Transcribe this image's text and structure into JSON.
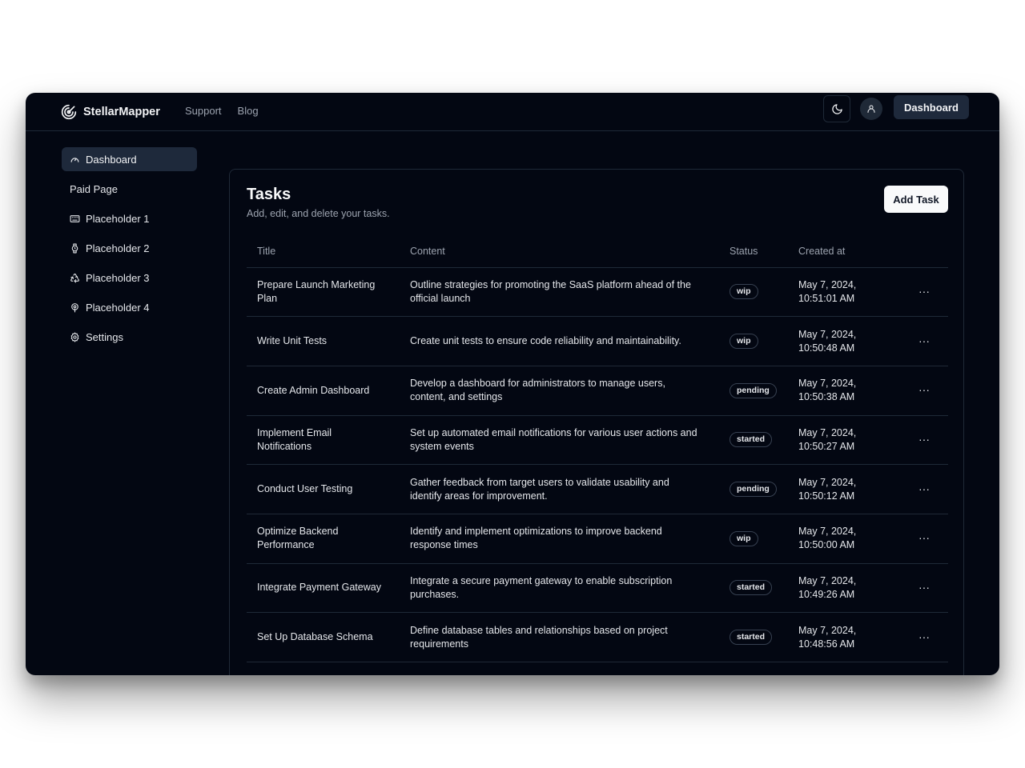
{
  "header": {
    "brand": "StellarMapper",
    "nav": [
      "Support",
      "Blog"
    ],
    "dashboard_button": "Dashboard"
  },
  "sidebar": {
    "items": [
      {
        "label": "Dashboard",
        "icon": "gauge-icon",
        "active": true
      },
      {
        "label": "Paid Page",
        "icon": "",
        "heading": true
      },
      {
        "label": "Placeholder 1",
        "icon": "keyboard-icon"
      },
      {
        "label": "Placeholder 2",
        "icon": "watch-icon"
      },
      {
        "label": "Placeholder 3",
        "icon": "recycle-icon"
      },
      {
        "label": "Placeholder 4",
        "icon": "podcast-icon"
      },
      {
        "label": "Settings",
        "icon": "gear-icon"
      }
    ]
  },
  "main": {
    "title": "Tasks",
    "subtitle": "Add, edit, and delete your tasks.",
    "add_button": "Add Task",
    "columns": [
      "Title",
      "Content",
      "Status",
      "Created at"
    ],
    "rows": [
      {
        "title": "Prepare Launch Marketing Plan",
        "content": "Outline strategies for promoting the SaaS platform ahead of the official launch",
        "status": "wip",
        "created_line1": "May 7, 2024,",
        "created_line2": "10:51:01 AM"
      },
      {
        "title": "Write Unit Tests",
        "content": "Create unit tests to ensure code reliability and maintainability.",
        "status": "wip",
        "created_line1": "May 7, 2024,",
        "created_line2": "10:50:48 AM"
      },
      {
        "title": "Create Admin Dashboard",
        "content": "Develop a dashboard for administrators to manage users, content, and settings",
        "status": "pending",
        "created_line1": "May 7, 2024,",
        "created_line2": "10:50:38 AM"
      },
      {
        "title": "Implement Email Notifications",
        "content": "Set up automated email notifications for various user actions and system events",
        "status": "started",
        "created_line1": "May 7, 2024,",
        "created_line2": "10:50:27 AM"
      },
      {
        "title": "Conduct User Testing",
        "content": "Gather feedback from target users to validate usability and identify areas for improvement.",
        "status": "pending",
        "created_line1": "May 7, 2024,",
        "created_line2": "10:50:12 AM"
      },
      {
        "title": "Optimize Backend Performance",
        "content": "Identify and implement optimizations to improve backend response times",
        "status": "wip",
        "created_line1": "May 7, 2024,",
        "created_line2": "10:50:00 AM"
      },
      {
        "title": "Integrate Payment Gateway",
        "content": "Integrate a secure payment gateway to enable subscription purchases.",
        "status": "started",
        "created_line1": "May 7, 2024,",
        "created_line2": "10:49:26 AM"
      },
      {
        "title": "Set Up Database Schema",
        "content": "Define database tables and relationships based on project requirements",
        "status": "started",
        "created_line1": "May 7, 2024,",
        "created_line2": "10:48:56 AM"
      }
    ],
    "row_action": "···"
  },
  "colors": {
    "background": "#030712",
    "border": "#1f2937",
    "active_bg": "#1e293b",
    "muted_text": "#9ca3af",
    "primary_button_bg": "#f9fafb"
  }
}
